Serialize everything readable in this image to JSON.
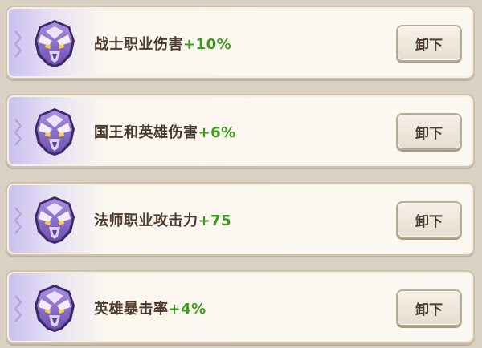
{
  "equipment_list": [
    {
      "name": "战士职业伤害",
      "bonus": "+10%",
      "action": "卸下",
      "icon": "purple-dragon-helmet-icon"
    },
    {
      "name": "国王和英雄伤害",
      "bonus": "+6%",
      "action": "卸下",
      "icon": "purple-dragon-helmet-icon"
    },
    {
      "name": "法师职业攻击力",
      "bonus": "+75",
      "action": "卸下",
      "icon": "purple-dragon-helmet-icon"
    },
    {
      "name": "英雄暴击率",
      "bonus": "+4%",
      "action": "卸下",
      "icon": "purple-dragon-helmet-icon"
    }
  ],
  "colors": {
    "accent_purple": "#8f6fd0",
    "bonus_green": "#3d9a1f",
    "text_brown": "#4a3a2c",
    "background": "#d9d2c4"
  }
}
